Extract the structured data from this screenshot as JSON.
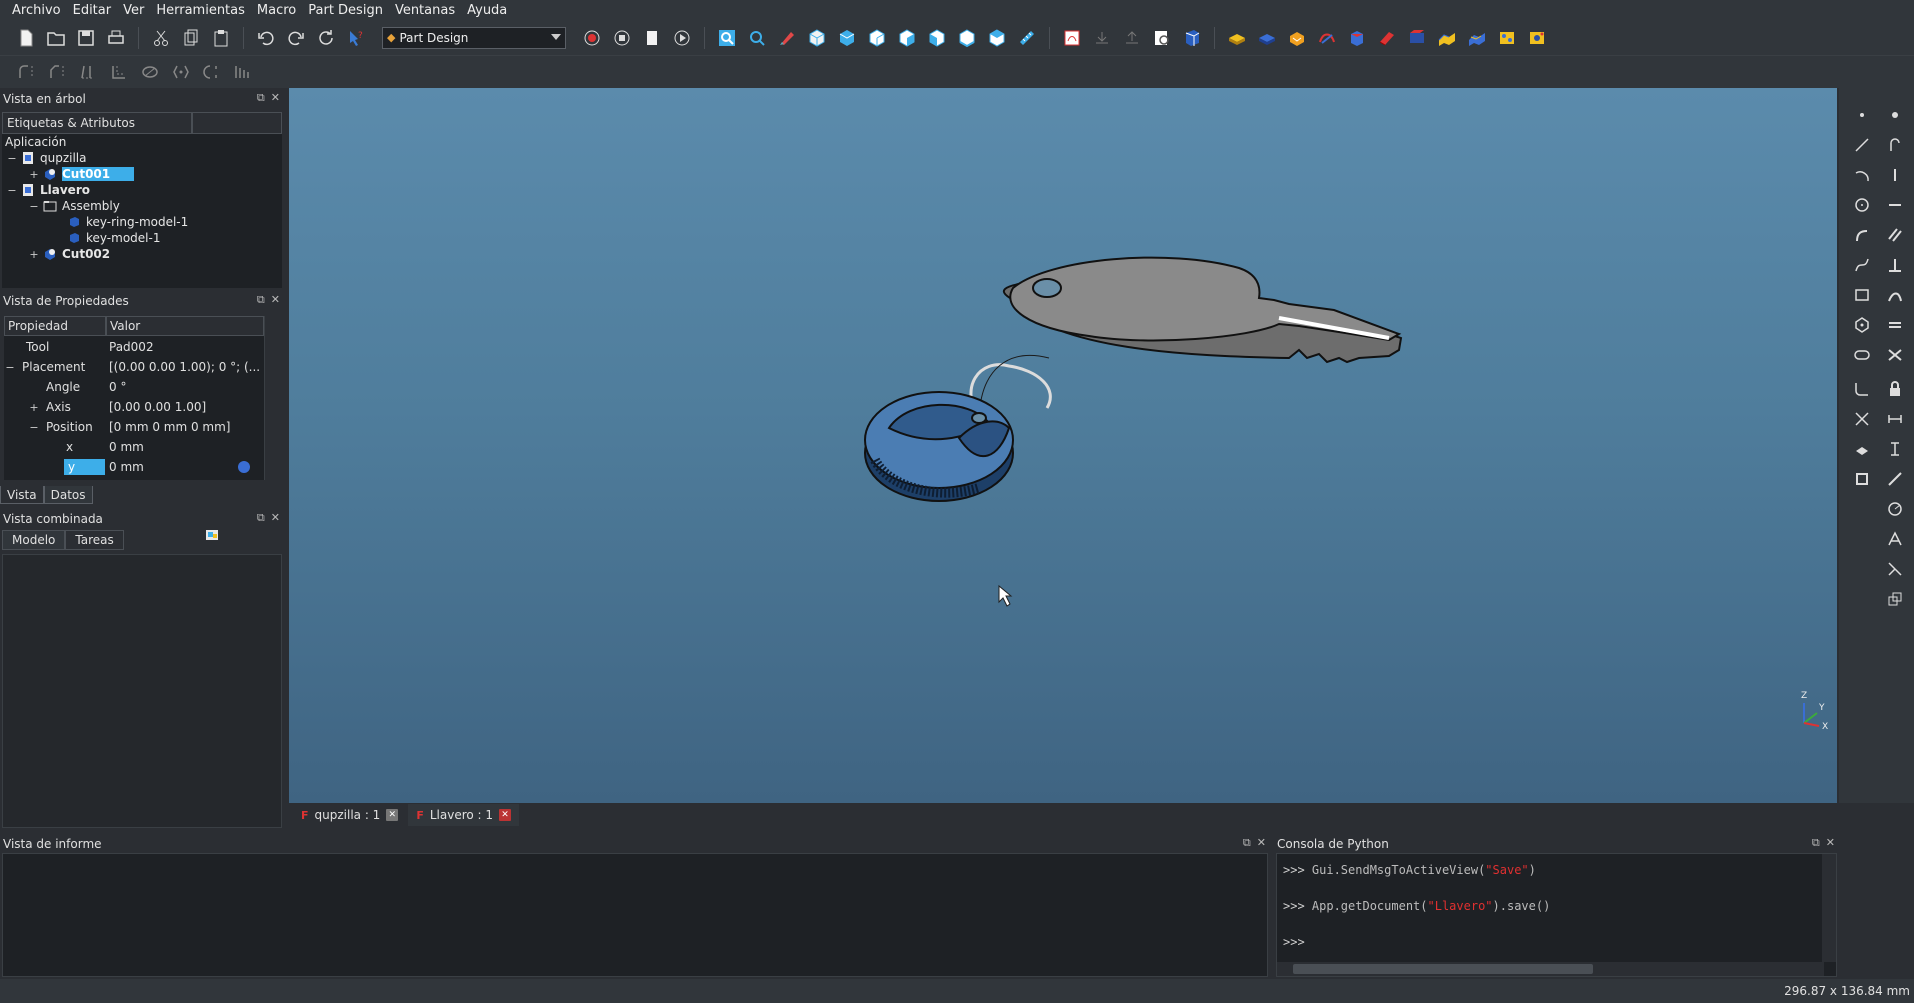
{
  "menu": [
    "Archivo",
    "Editar",
    "Ver",
    "Herramientas",
    "Macro",
    "Part Design",
    "Ventanas",
    "Ayuda"
  ],
  "workbench": {
    "selected": "Part Design"
  },
  "tree_panel": {
    "title": "Vista en árbol",
    "col1": "Etiquetas & Atributos",
    "col2": "",
    "root": "Aplicación",
    "items": [
      {
        "label": "qupzilla",
        "toggle": "−",
        "icon": "document-icon"
      },
      {
        "label": "Cut001",
        "toggle": "+",
        "icon": "part-feature-icon"
      },
      {
        "label": "Llavero",
        "toggle": "−",
        "icon": "document-icon"
      },
      {
        "label": "Assembly",
        "toggle": "−",
        "icon": "folder-icon"
      },
      {
        "label": "key-ring-model-1",
        "toggle": "",
        "icon": "mesh-icon"
      },
      {
        "label": "key-model-1",
        "toggle": "",
        "icon": "mesh-icon"
      },
      {
        "label": "Cut002",
        "toggle": "+",
        "icon": "part-feature-icon"
      }
    ]
  },
  "property_panel": {
    "title": "Vista de Propiedades",
    "col_property": "Propiedad",
    "col_value": "Valor",
    "rows": [
      {
        "name": "Tool",
        "value": "Pad002",
        "toggle": ""
      },
      {
        "name": "Placement",
        "value": "[(0.00 0.00 1.00); 0 °; (...",
        "toggle": "−"
      },
      {
        "name": "Angle",
        "value": "0 °",
        "toggle": ""
      },
      {
        "name": "Axis",
        "value": "[0.00 0.00 1.00]",
        "toggle": "+"
      },
      {
        "name": "Position",
        "value": "[0 mm  0 mm  0 mm]",
        "toggle": "−"
      },
      {
        "name": "x",
        "value": "0 mm",
        "toggle": ""
      },
      {
        "name": "y",
        "value": "0 mm",
        "toggle": ""
      }
    ],
    "tabs": [
      "Vista",
      "Datos"
    ]
  },
  "combo_panel": {
    "title": "Vista combinada",
    "tabs": [
      "Modelo",
      "Tareas"
    ]
  },
  "view_tabs": [
    {
      "label": "qupzilla : 1"
    },
    {
      "label": "Llavero : 1"
    }
  ],
  "axis_labels": {
    "z": "Z",
    "y": "Y",
    "x": "X"
  },
  "report_panel": {
    "title": "Vista de informe"
  },
  "python_panel": {
    "title": "Consola de Python",
    "lines": [
      {
        "prompt": ">>> ",
        "code1": "Gui.SendMsgToActiveView(",
        "str": "\"Save\"",
        "code2": ")"
      },
      {
        "prompt": ">>> ",
        "code1": "App.getDocument(",
        "str": "\"Llavero\"",
        "code2": ").save()"
      },
      {
        "prompt": ">>> ",
        "code1": "",
        "str": "",
        "code2": ""
      }
    ]
  },
  "status": {
    "dimensions": "296.87 x 136.84 mm"
  },
  "colors": {
    "accent": "#3daee9",
    "view_top": "#5b8bac",
    "view_bottom": "#3f6482",
    "error_red": "#e03030"
  }
}
